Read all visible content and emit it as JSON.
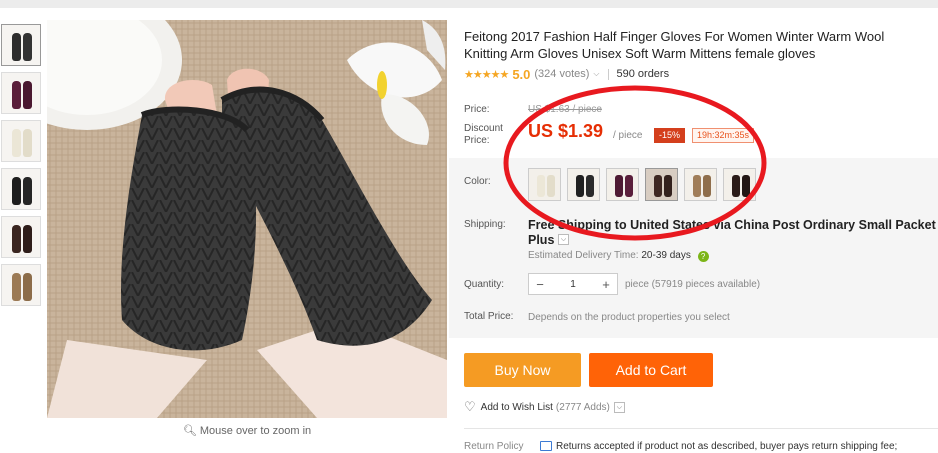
{
  "product": {
    "title": "Feitong 2017 Fashion Half Finger Gloves For Women Winter Warm Wool Knitting Arm Gloves Unisex Soft Warm Mittens female gloves",
    "rating_value": "5.0",
    "rating_votes": "(324 votes)",
    "orders": "590 orders",
    "rating_stars": 5
  },
  "price": {
    "label": "Price:",
    "original": "US $1.63 / piece",
    "discount_label_1": "Discount",
    "discount_label_2": "Price:",
    "discount": "US $1.39",
    "per_piece": "/ piece",
    "discount_badge": "-15%",
    "timer": "19h:32m:35s"
  },
  "color": {
    "label": "Color:",
    "swatches": [
      "white",
      "black",
      "purple",
      "coffee",
      "camel",
      "dark-brown"
    ]
  },
  "shipping": {
    "label": "Shipping:",
    "text": "Free Shipping to United States via China Post Ordinary Small Packet",
    "text_line2": "Plus",
    "caret": "⌵",
    "estimated_label": "Estimated Delivery Time:",
    "estimated_days": "20-39 days",
    "help": "?"
  },
  "quantity": {
    "label": "Quantity:",
    "minus": "−",
    "value": "1",
    "plus": "+",
    "info": "piece (57919 pieces available)"
  },
  "total": {
    "label": "Total Price:",
    "value": "Depends on the product properties you select"
  },
  "actions": {
    "buy_now": "Buy Now",
    "add_to_cart": "Add to Cart",
    "wish_label": "Add to Wish List",
    "wish_count": "(2777 Adds)",
    "wish_caret": "⌵"
  },
  "return_policy": {
    "label": "Return Policy",
    "text": "Returns accepted if product not as described, buyer pays return shipping fee;"
  },
  "gallery": {
    "zoom_hint": "Mouse over to zoom in",
    "thumbnail_colors": [
      "black",
      "purple",
      "white",
      "black",
      "coffee",
      "camel"
    ]
  },
  "colors": {
    "price_red": "#e62e04",
    "buy_now_bg": "#f59b23",
    "add_to_cart_bg": "#ff6307",
    "star": "#f5a623",
    "annotation_circle": "#e8191f"
  }
}
